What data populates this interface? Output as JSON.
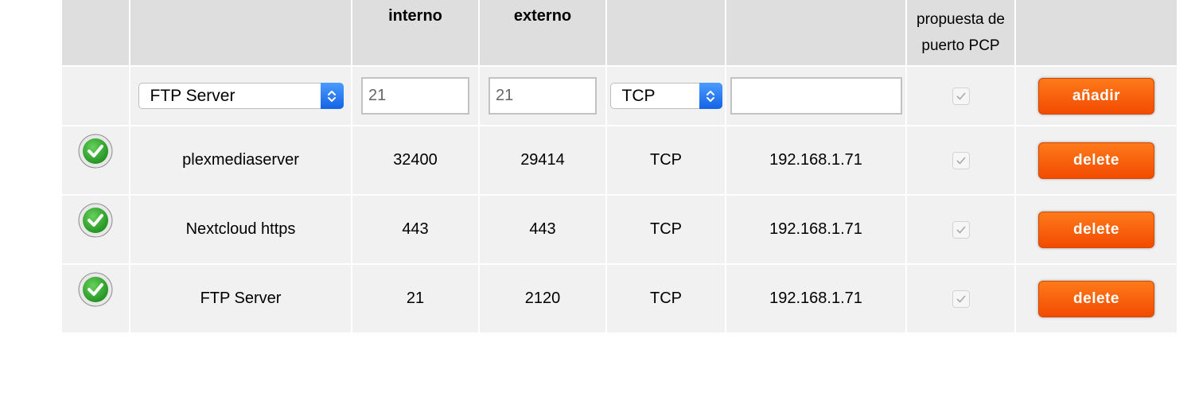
{
  "header": {
    "col1": "",
    "col2": "",
    "internal": "interno",
    "external": "externo",
    "col5": "",
    "col6": "",
    "pcp_line1": "propuesta de",
    "pcp_line2": "puerto PCP",
    "col8": ""
  },
  "add_row": {
    "service_value": "FTP Server",
    "internal_port": "21",
    "external_port": "21",
    "protocol_value": "TCP",
    "ip_value": "",
    "pcp_checked": true,
    "add_label": "añadir"
  },
  "rows": [
    {
      "status": "ok-icon",
      "name": "plexmediaserver",
      "internal": "32400",
      "external": "29414",
      "protocol": "TCP",
      "ip": "192.168.1.71",
      "pcp": true,
      "action": "delete"
    },
    {
      "status": "ok-icon",
      "name": "Nextcloud https",
      "internal": "443",
      "external": "443",
      "protocol": "TCP",
      "ip": "192.168.1.71",
      "pcp": true,
      "action": "delete"
    },
    {
      "status": "ok-icon",
      "name": "FTP Server",
      "internal": "21",
      "external": "2120",
      "protocol": "TCP",
      "ip": "192.168.1.71",
      "pcp": true,
      "action": "delete"
    }
  ],
  "colors": {
    "header_bg": "#dedede",
    "row_bg": "#f1f1f1",
    "button_orange": "#f25a00",
    "ok_green": "#2aa12a"
  }
}
